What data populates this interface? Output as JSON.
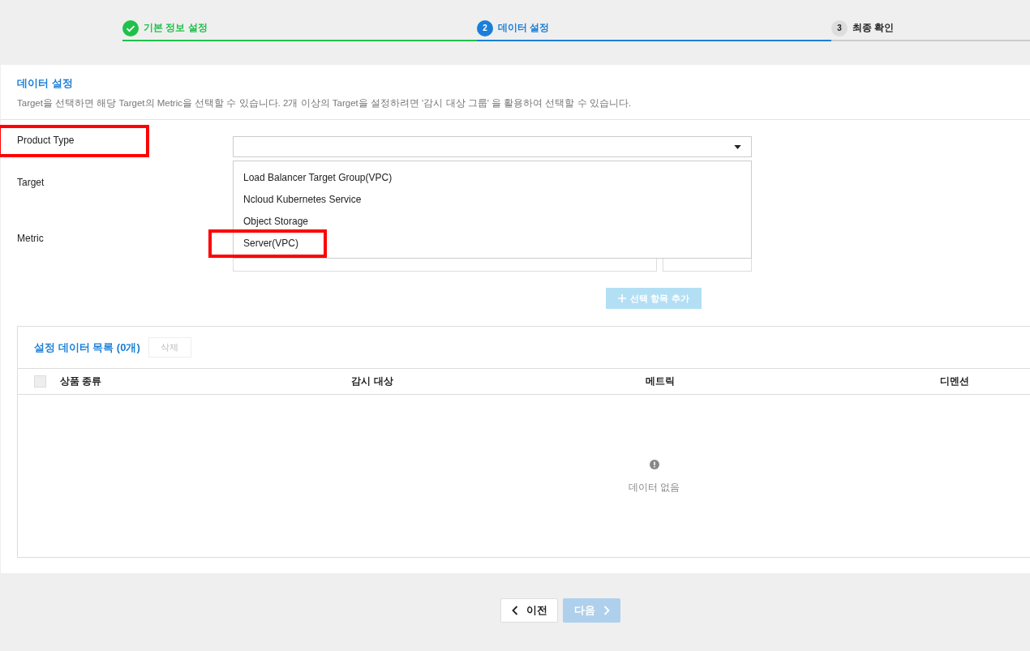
{
  "steps": [
    {
      "label": "기본 정보 설정",
      "completed": true,
      "selected": false
    },
    {
      "number": "2",
      "label": "데이터 설정",
      "completed": false,
      "selected": true
    },
    {
      "number": "3",
      "label": "최종 확인",
      "completed": false,
      "selected": false
    }
  ],
  "section": {
    "title": "데이터 설정",
    "description": "Target을 선택하면 해당 Target의 Metric을 선택할 수 있습니다. 2개 이상의 Target을 설정하려면 '감시 대상 그룹' 을 활용하여 선택할 수 있습니다."
  },
  "form": {
    "product_type": {
      "label": "Product Type",
      "highlighted": true,
      "expanded": true,
      "options": [
        {
          "label": "Load Balancer Target Group(VPC)",
          "highlighted": false
        },
        {
          "label": "Ncloud Kubernetes Service",
          "highlighted": false
        },
        {
          "label": "Object Storage",
          "highlighted": false
        },
        {
          "label": "Server(VPC)",
          "highlighted": true
        }
      ]
    },
    "target": {
      "label": "Target"
    },
    "metric": {
      "label": "Metric"
    },
    "add_button": {
      "label": "선택 항목 추가",
      "disabled": true
    }
  },
  "table": {
    "title": "설정 데이터 목록 (0개)",
    "delete_button": {
      "label": "삭제",
      "disabled": true
    },
    "select_all": {
      "checked": false,
      "disabled": true
    },
    "columns": [
      "상품 종류",
      "감시 대상",
      "메트릭",
      "디멘션"
    ],
    "empty_text": "데이터 없음"
  },
  "footer": {
    "prev_button": {
      "label": "이전",
      "disabled": false
    },
    "next_button": {
      "label": "다음",
      "disabled": true
    }
  }
}
